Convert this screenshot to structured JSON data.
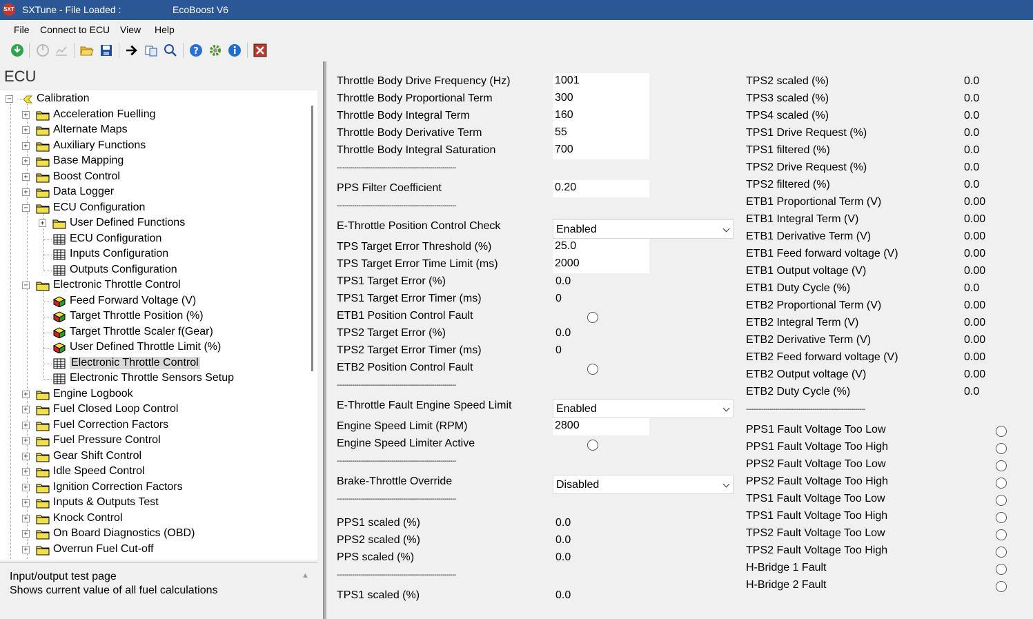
{
  "title": {
    "app": "SXTune - File Loaded :",
    "file": "EcoBoost V6"
  },
  "menu": [
    "File",
    "Connect to ECU",
    "View",
    "Help"
  ],
  "ecu_title": "ECU",
  "tree": {
    "root": "Calibration",
    "items": [
      "Acceleration Fuelling",
      "Alternate Maps",
      "Auxiliary Functions",
      "Base Mapping",
      "Boost Control",
      "Data Logger",
      "ECU Configuration",
      "User Defined Functions",
      "ECU Configuration",
      "Inputs Configuration",
      "Outputs Configuration",
      "Electronic Throttle Control",
      "Feed Forward Voltage (V)",
      "Target Throttle Position (%)",
      "Target Throttle Scaler f(Gear)",
      "User Defined Throttle Limit (%)",
      "Electronic Throttle Control",
      "Electronic Throttle Sensors Setup",
      "Engine Logbook",
      "Fuel Closed Loop Control",
      "Fuel Correction Factors",
      "Fuel Pressure Control",
      "Gear Shift Control",
      "Idle Speed Control",
      "Ignition Correction Factors",
      "Inputs & Outputs Test",
      "Knock Control",
      "On Board Diagnostics (OBD)",
      "Overrun Fuel Cut-off"
    ]
  },
  "info": {
    "line1": "Input/output test page",
    "line2": "Shows current value of all fuel calculations"
  },
  "dashes": "-------------------------------------------------------------",
  "left": {
    "freq_label": "Throttle Body Drive Frequency (Hz)",
    "freq": "1001",
    "prop_label": "Throttle Body Proportional Term",
    "prop": "300",
    "int_label": "Throttle Body Integral Term",
    "int": "160",
    "der_label": "Throttle Body Derivative Term",
    "der": "55",
    "sat_label": "Throttle Body Integral Saturation",
    "sat": "700",
    "pps_filter_label": "PPS Filter Coefficient",
    "pps_filter": "0.20",
    "pos_check_label": "E-Throttle Position Control Check",
    "pos_check": "Enabled",
    "err_thresh_label": "TPS Target Error Threshold (%)",
    "err_thresh": "25.0",
    "err_time_label": "TPS Target Error Time Limit (ms)",
    "err_time": "2000",
    "tps1_err_label": "TPS1 Target Error (%)",
    "tps1_err": "0.0",
    "tps1_timer_label": "TPS1 Target Error Timer (ms)",
    "tps1_timer": "0",
    "etb1_fault_label": "ETB1 Position Control Fault",
    "tps2_err_label": "TPS2 Target Error (%)",
    "tps2_err": "0.0",
    "tps2_timer_label": "TPS2 Target Error Timer (ms)",
    "tps2_timer": "0",
    "etb2_fault_label": "ETB2 Position Control Fault",
    "speed_limit_label": "E-Throttle Fault Engine Speed Limit",
    "speed_limit": "Enabled",
    "rpm_label": "Engine Speed Limit (RPM)",
    "rpm": "2800",
    "limiter_label": "Engine Speed Limiter Active",
    "brake_label": "Brake-Throttle Override",
    "brake": "Disabled",
    "pps1_label": "PPS1 scaled (%)",
    "pps1": "0.0",
    "pps2_label": "PPS2 scaled (%)",
    "pps2": "0.0",
    "pps_label": "PPS scaled (%)",
    "pps": "0.0",
    "tps1s_label": "TPS1 scaled (%)",
    "tps1s": "0.0"
  },
  "right": {
    "values": [
      {
        "label": "TPS2 scaled (%)",
        "value": "0.0"
      },
      {
        "label": "TPS3 scaled (%)",
        "value": "0.0"
      },
      {
        "label": "TPS4 scaled (%)",
        "value": "0.0"
      },
      {
        "label": "TPS1 Drive Request (%)",
        "value": "0.0"
      },
      {
        "label": "TPS1 filtered (%)",
        "value": "0.0"
      },
      {
        "label": "TPS2 Drive Request (%)",
        "value": "0.0"
      },
      {
        "label": "TPS2 filtered (%)",
        "value": "0.0"
      },
      {
        "label": "ETB1 Proportional Term (V)",
        "value": "0.00"
      },
      {
        "label": "ETB1 Integral Term (V)",
        "value": "0.00"
      },
      {
        "label": "ETB1 Derivative Term (V)",
        "value": "0.00"
      },
      {
        "label": "ETB1 Feed forward voltage (V)",
        "value": "0.00"
      },
      {
        "label": "ETB1 Output voltage (V)",
        "value": "0.00"
      },
      {
        "label": "ETB1 Duty Cycle (%)",
        "value": "0.0"
      },
      {
        "label": "ETB2 Proportional Term (V)",
        "value": "0.00"
      },
      {
        "label": "ETB2 Integral Term (V)",
        "value": "0.00"
      },
      {
        "label": "ETB2 Derivative Term (V)",
        "value": "0.00"
      },
      {
        "label": "ETB2 Feed forward voltage (V)",
        "value": "0.00"
      },
      {
        "label": "ETB2 Output voltage (V)",
        "value": "0.00"
      },
      {
        "label": "ETB2 Duty Cycle (%)",
        "value": "0.0"
      }
    ],
    "faults": [
      "PPS1 Fault Voltage Too Low",
      "PPS1 Fault Voltage Too High",
      "PPS2 Fault Voltage Too Low",
      "PPS2 Fault Voltage Too High",
      "TPS1 Fault Voltage Too Low",
      "TPS1 Fault Voltage Too High",
      "TPS2 Fault Voltage Too Low",
      "TPS2 Fault Voltage Too High",
      "H-Bridge 1 Fault",
      "H-Bridge 2 Fault"
    ]
  }
}
